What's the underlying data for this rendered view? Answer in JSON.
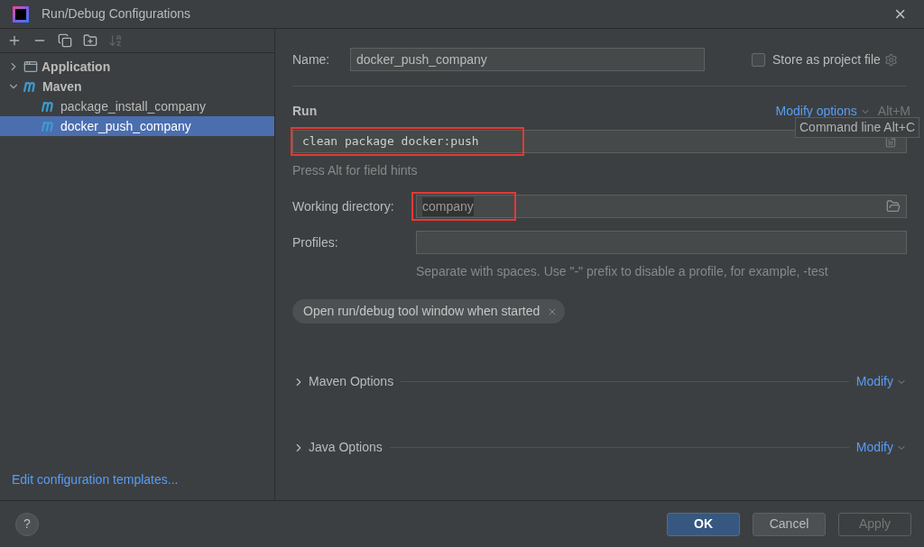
{
  "window": {
    "title": "Run/Debug Configurations",
    "close": "×"
  },
  "toolbar": [
    {
      "kind": "add",
      "disabled": false
    },
    {
      "kind": "remove",
      "disabled": false
    },
    {
      "kind": "copy",
      "disabled": false
    },
    {
      "kind": "folder",
      "disabled": false
    },
    {
      "kind": "sort",
      "disabled": true
    }
  ],
  "tree": [
    {
      "label": "Application",
      "kind": "application",
      "expanded": false,
      "selected": false
    },
    {
      "label": "Maven",
      "kind": "maven",
      "expanded": true,
      "selected": false,
      "children": [
        {
          "label": "package_install_company",
          "kind": "maven",
          "selected": false
        },
        {
          "label": "docker_push_company",
          "kind": "maven",
          "selected": true
        }
      ]
    }
  ],
  "templates_link": "Edit configuration templates...",
  "name": {
    "label": "Name:",
    "value": "docker_push_company"
  },
  "store": {
    "label": "Store as project file",
    "checked": false
  },
  "run": {
    "title": "Run",
    "modify_options": "Modify options",
    "shortcut": "Alt+M",
    "tooltip": "Command line Alt+C",
    "command": "clean package docker:push",
    "command_annotated": true,
    "hint": "Press Alt for field hints"
  },
  "working_directory": {
    "label": "Working directory:",
    "value": "company",
    "annotated": true
  },
  "profiles": {
    "label": "Profiles:",
    "hint": "Separate with spaces. Use \"-\" prefix to disable a profile, for example, -test"
  },
  "chips": [
    {
      "label": "Open run/debug tool window when started"
    }
  ],
  "sections": [
    {
      "label": "Maven Options",
      "expanded": false,
      "action": "Modify"
    },
    {
      "label": "Java Options",
      "expanded": false,
      "action": "Modify"
    }
  ],
  "footer": {
    "help": "?",
    "buttons": [
      {
        "label": "OK",
        "default": true,
        "disabled": false
      },
      {
        "label": "Cancel",
        "default": false,
        "disabled": false
      },
      {
        "label": "Apply",
        "disabled": true
      }
    ]
  }
}
